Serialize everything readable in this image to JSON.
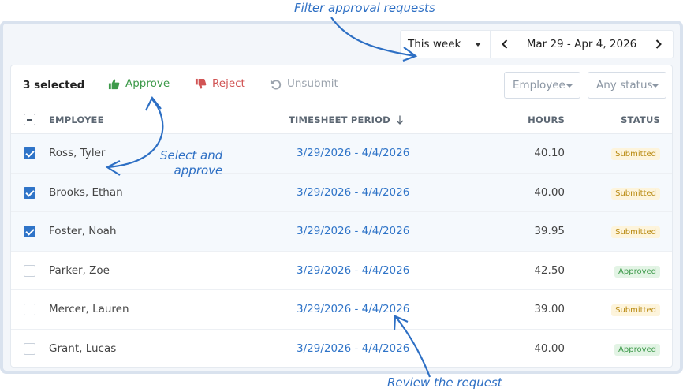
{
  "filters": {
    "range_label": "This week",
    "date_range": "Mar 29 - Apr 4, 2026"
  },
  "toolbar": {
    "selected_text": "3 selected",
    "approve_label": "Approve",
    "reject_label": "Reject",
    "unsubmit_label": "Unsubmit",
    "employee_filter": "Employee",
    "status_filter": "Any status"
  },
  "table": {
    "headers": {
      "employee": "EMPLOYEE",
      "period": "TIMESHEET PERIOD",
      "hours": "HOURS",
      "status": "STATUS"
    },
    "rows": [
      {
        "employee": "Ross, Tyler",
        "period": "3/29/2026 - 4/4/2026",
        "hours": "40.10",
        "status": "Submitted"
      },
      {
        "employee": "Brooks, Ethan",
        "period": "3/29/2026 - 4/4/2026",
        "hours": "40.00",
        "status": "Submitted"
      },
      {
        "employee": "Foster, Noah",
        "period": "3/29/2026 - 4/4/2026",
        "hours": "39.95",
        "status": "Submitted"
      },
      {
        "employee": "Parker, Zoe",
        "period": "3/29/2026 - 4/4/2026",
        "hours": "42.50",
        "status": "Approved"
      },
      {
        "employee": "Mercer, Lauren",
        "period": "3/29/2026 - 4/4/2026",
        "hours": "39.00",
        "status": "Submitted"
      },
      {
        "employee": "Grant, Lucas",
        "period": "3/29/2026 - 4/4/2026",
        "hours": "40.00",
        "status": "Approved"
      }
    ]
  },
  "annotations": {
    "filter": "Filter approval requests",
    "select_line1": "Select and",
    "select_line2": "approve",
    "review": "Review the request"
  },
  "colors": {
    "accent": "#2f74c8",
    "approve": "#3d9a4a",
    "reject": "#d15454",
    "submitted_bg": "#fdf4dc",
    "approved_bg": "#e3f4e5"
  },
  "icons": {
    "approve": "thumbs-up-icon",
    "reject": "thumbs-down-icon",
    "unsubmit": "undo-icon",
    "prev": "chevron-left-icon",
    "next": "chevron-right-icon",
    "sort": "arrow-down-icon"
  }
}
